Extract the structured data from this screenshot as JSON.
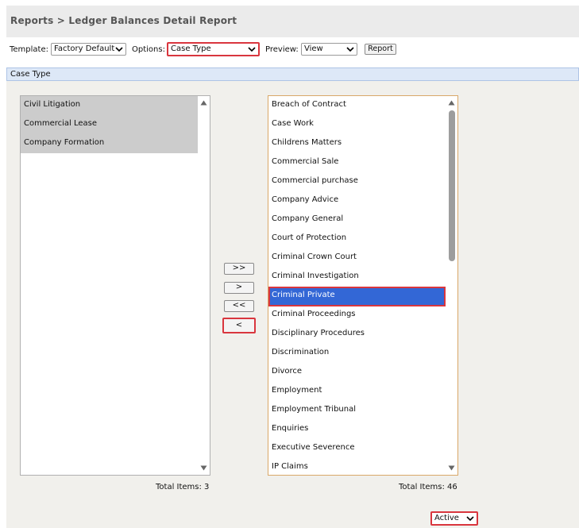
{
  "header": {
    "title": "Reports > Ledger Balances Detail Report"
  },
  "toolbar": {
    "template_label": "Template:",
    "template_value": "Factory Default",
    "options_label": "Options:",
    "options_value": "Case Type",
    "preview_label": "Preview:",
    "preview_value": "View",
    "report_button": "Report"
  },
  "section": {
    "title": "Case Type"
  },
  "left_list": {
    "items": [
      "Civil Litigation",
      "Commercial Lease",
      "Company Formation"
    ],
    "total_label": "Total Items: 3"
  },
  "move_buttons": {
    "add_all": ">>",
    "add": ">",
    "remove_all": "<<",
    "remove": "<"
  },
  "right_list": {
    "items": [
      "Breach of Contract",
      "Case Work",
      "Childrens Matters",
      "Commercial Sale",
      "Commercial purchase",
      "Company Advice",
      "Company General",
      "Court of Protection",
      "Criminal Crown Court",
      "Criminal Investigation",
      "Criminal Private",
      "Criminal Proceedings",
      "Disciplinary Procedures",
      "Discrimination",
      "Divorce",
      "Employment",
      "Employment Tribunal",
      "Enquiries",
      "Executive Severence",
      "IP Claims"
    ],
    "selected": "Criminal Private",
    "total_label": "Total Items: 46"
  },
  "status_filter": {
    "value": "Active"
  },
  "colors": {
    "highlight_border": "#d9363e",
    "selection": "#3367d6",
    "section_bg": "#dde8f7"
  }
}
